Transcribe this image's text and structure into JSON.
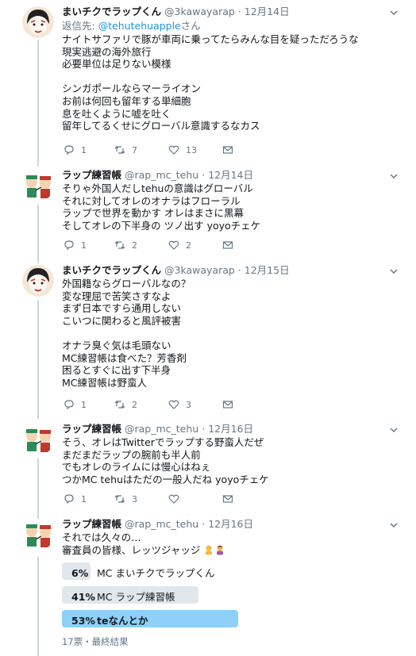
{
  "tweets": [
    {
      "name": "まいチクでラップくん",
      "handle": "@3kawayarap",
      "time": "12月14日",
      "reply_prefix": "返信先: ",
      "reply_to": "@tehutehuapple",
      "reply_suffix": "さん",
      "lines": [
        "ナイトサファリで豚が車両に乗ってたらみんな目を疑っただろうな",
        "現実逃避の海外旅行",
        "必要単位は足りない模様",
        "",
        "シンガポールならマーライオン",
        "お前は何回も留年する単細胞",
        "息を吐くように嘘を吐く",
        "留年してるくせにグローバル意識するなカス"
      ],
      "counts": {
        "reply": "1",
        "retweet": "7",
        "like": "13"
      }
    },
    {
      "name": "ラップ練習帳",
      "handle": "@rap_mc_tehu",
      "time": "12月14日",
      "lines": [
        "そりゃ外国人だしtehuの意識はグローバル",
        "それに対してオレのオナラはフローラル",
        "ラップで世界を動かす オレはまさに黒幕",
        "そしてオレの下半身の ツノ出す yoyoチェケ"
      ],
      "counts": {
        "reply": "1",
        "retweet": "2",
        "like": "2"
      }
    },
    {
      "name": "まいチクでラップくん",
      "handle": "@3kawayarap",
      "time": "12月15日",
      "lines": [
        "外国籍ならグローバルなの？",
        "変な理屈で苦笑さすなよ",
        "まず日本ですら通用しない",
        "こいつに関わると風評被害",
        "",
        "オナラ臭ぐ気は毛頭ない",
        "MC練習帳は食べた？芳香剤",
        "困るとすぐに出す下半身",
        "MC練習帳は野蛮人"
      ],
      "counts": {
        "reply": "1",
        "retweet": "2",
        "like": "3"
      }
    },
    {
      "name": "ラップ練習帳",
      "handle": "@rap_mc_tehu",
      "time": "12月16日",
      "lines": [
        "そう、オレはTwitterでラップする野蛮人だぜ",
        "まだまだラップの腕前も半人前",
        "でもオレのライムには慢心はねぇ",
        "つかMC tehuはただの一般人だね yoyoチェケ"
      ],
      "counts": {
        "reply": "1",
        "retweet": "3",
        "like": ""
      }
    },
    {
      "name": "ラップ練習帳",
      "handle": "@rap_mc_tehu",
      "time": "12月16日",
      "lines": [
        "それでは久々の…",
        "審査員の皆様、レッツジャッジ"
      ],
      "poll": [
        {
          "pct": "6%",
          "label": "MC まいチクでラップくん",
          "fraction": 0.06
        },
        {
          "pct": "41%",
          "label": "MC ラップ練習帳",
          "fraction": 0.41
        },
        {
          "pct": "53%",
          "label": "teなんとか",
          "fraction": 0.53
        }
      ],
      "poll_footer": "17票・最終結果"
    }
  ],
  "colors": {
    "accent": "#1b95e0",
    "muted": "#657786",
    "poll_win": "#8ed0f9",
    "poll_bar": "#e1e8ed"
  }
}
